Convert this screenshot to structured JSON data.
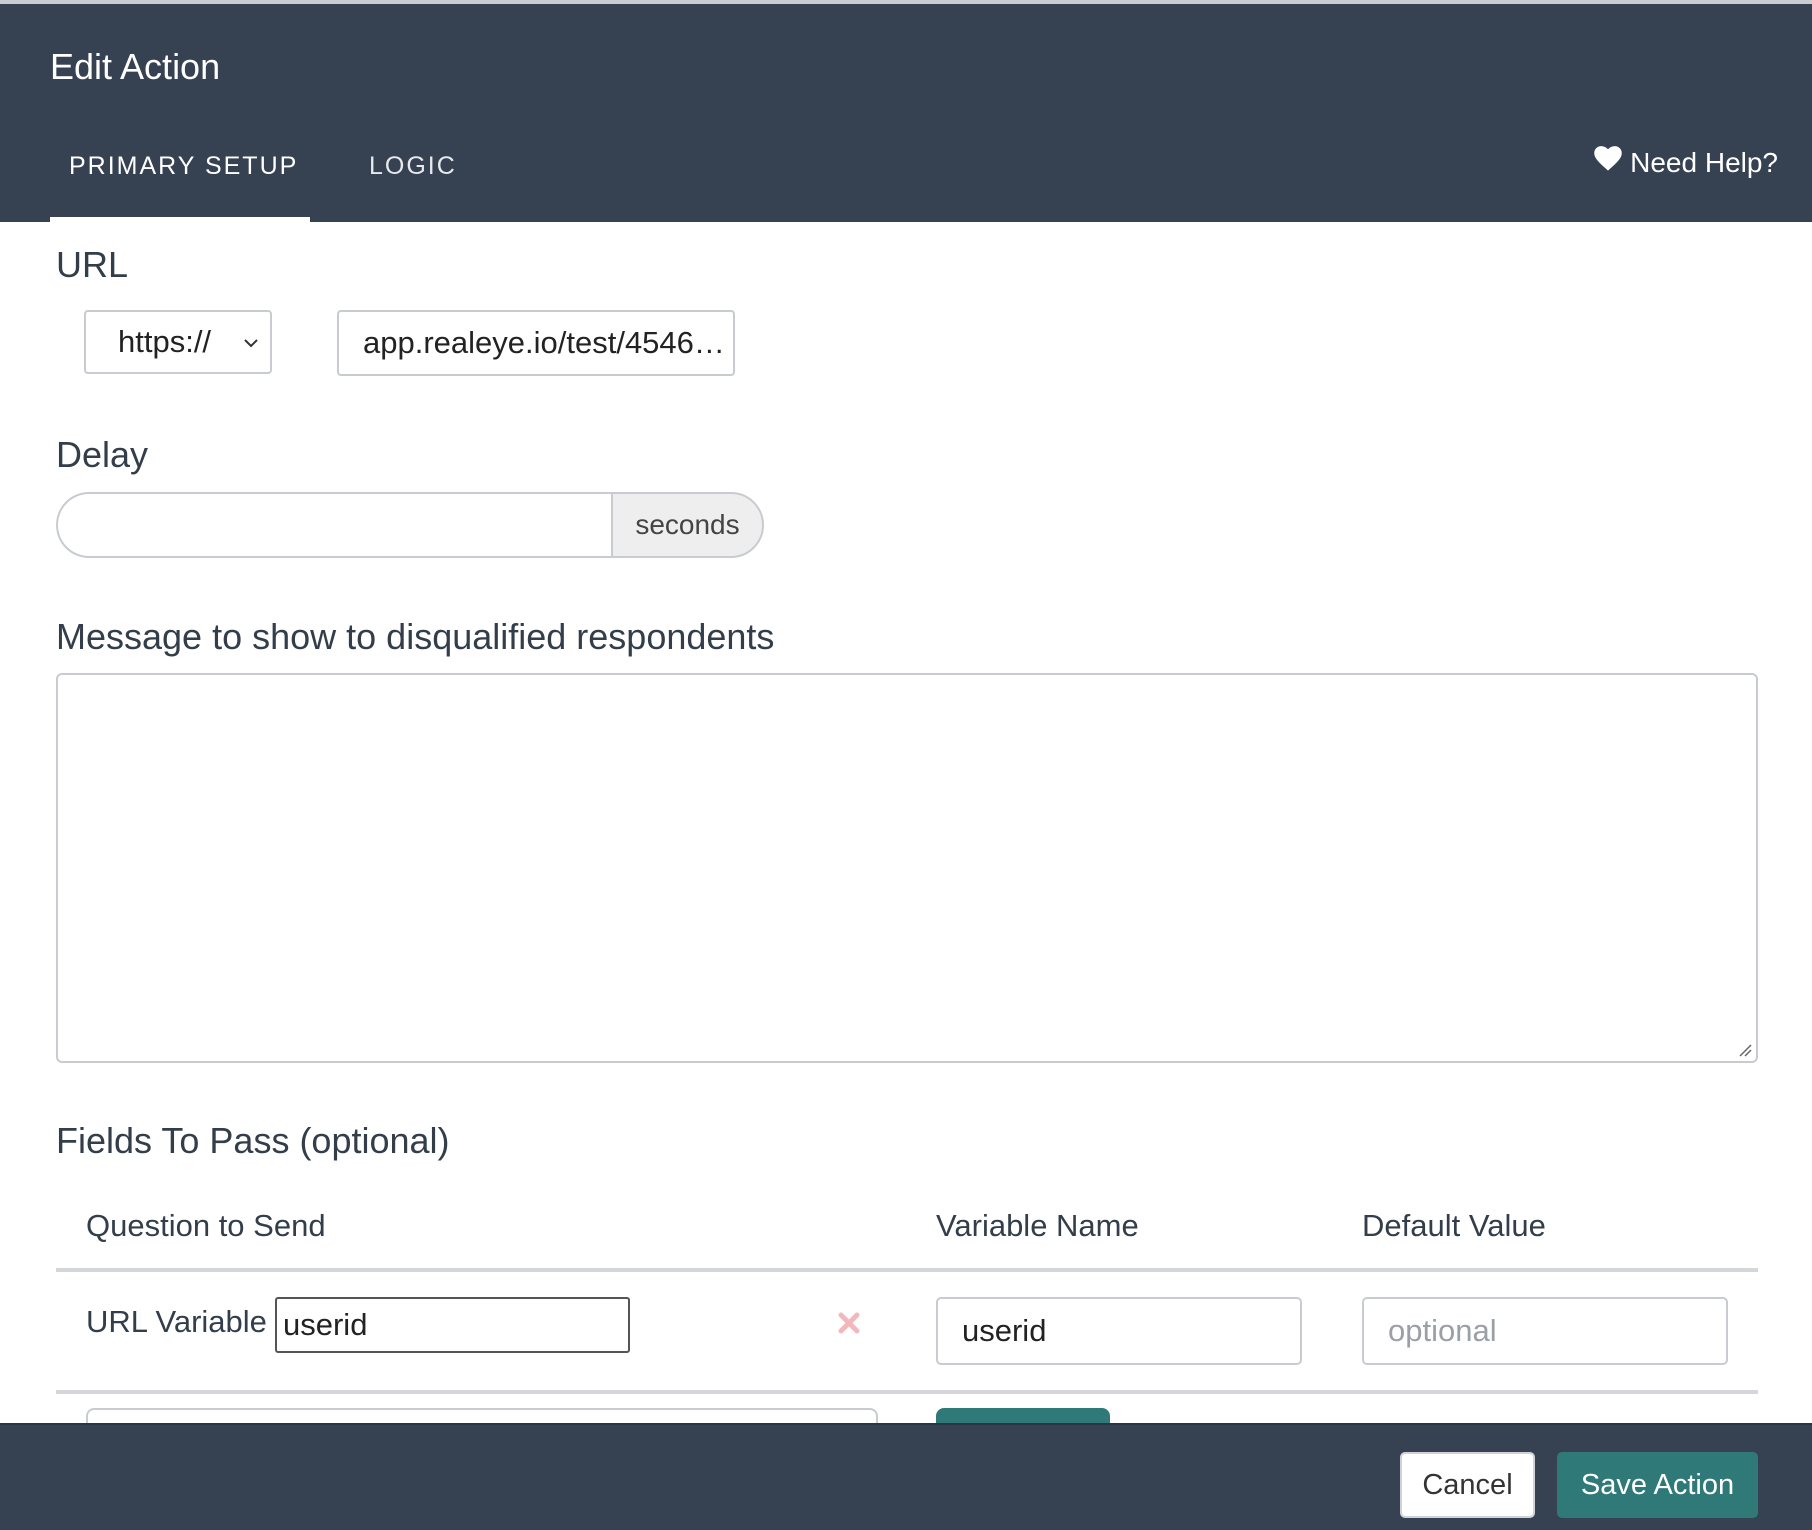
{
  "header": {
    "title": "Edit Action",
    "tabs": [
      {
        "label": "PRIMARY SETUP",
        "active": true
      },
      {
        "label": "LOGIC",
        "active": false
      }
    ],
    "help_label": "Need Help?",
    "help_icon": "heart-icon"
  },
  "url_section": {
    "label": "URL",
    "protocol_value": "https://",
    "url_value": "app.realeye.io/test/4546…"
  },
  "delay_section": {
    "label": "Delay",
    "value": "",
    "addon": "seconds"
  },
  "message_section": {
    "label": "Message to show to disqualified respondents",
    "value": ""
  },
  "fields_section": {
    "label": "Fields To Pass (optional)",
    "columns": [
      "Question to Send",
      "Variable Name",
      "Default Value"
    ],
    "rows": [
      {
        "type_label": "URL Variable",
        "question_value": "userid",
        "variable_name": "userid",
        "default_placeholder": "optional"
      }
    ]
  },
  "footer": {
    "cancel_label": "Cancel",
    "save_label": "Save Action"
  },
  "colors": {
    "header_bg": "#364152",
    "accent": "#2f7a78",
    "remove_icon": "#f2b8bd"
  }
}
